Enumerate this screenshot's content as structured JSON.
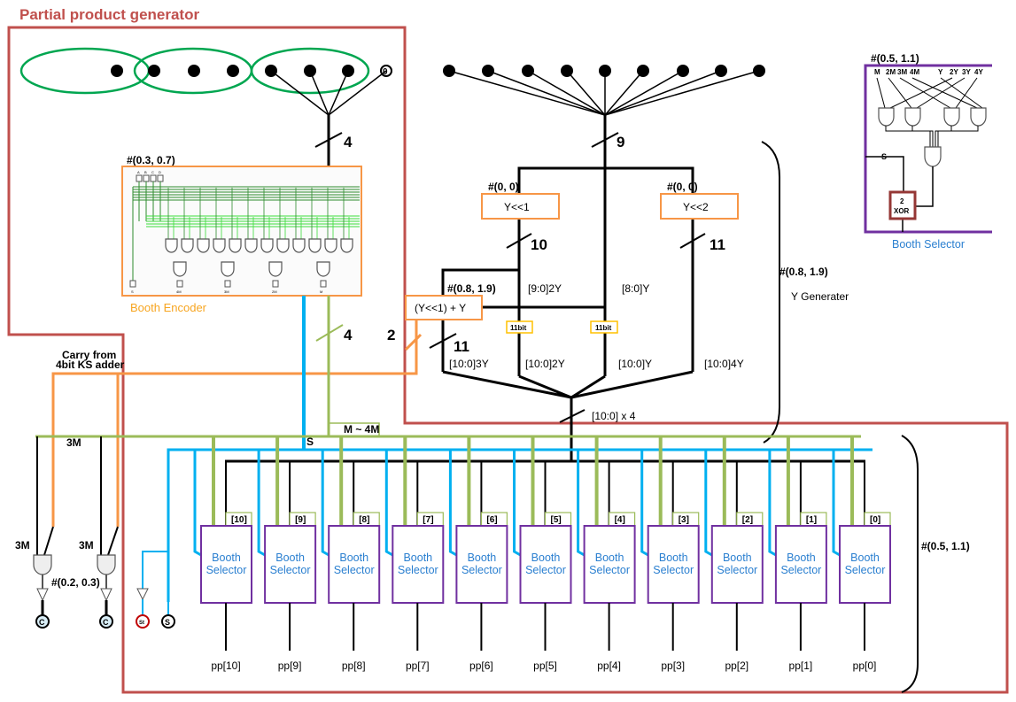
{
  "title": "Partial product generator",
  "colors": {
    "frame": "#c0504d",
    "green": "#9bbb59",
    "blue": "#00b0f0",
    "orange": "#f79646",
    "purple": "#7030a0",
    "yellow": "#ffc000",
    "brown": "#953735"
  },
  "top_left": {
    "zero_label": "0",
    "bus_width": "4"
  },
  "top_right": {
    "bus_width": "9"
  },
  "encoder": {
    "tag": "#(0.3, 0.7)",
    "label": "Booth Encoder",
    "inputs": [
      "A",
      "B",
      "C",
      "D"
    ],
    "outputs": [
      "S",
      "4M",
      "3M",
      "2M",
      "M"
    ],
    "bus_width": "4"
  },
  "ygen": {
    "shift1": "Y<<1",
    "shift1_tag": "#(0, 0)",
    "shift1_width": "10",
    "shift2": "Y<<2",
    "shift2_tag": "#(0, 0)",
    "shift2_width": "11",
    "add": "(Y<<1) + Y",
    "add_tag": "#(0.8, 1.9)",
    "add_width": "11",
    "carry_width": "2",
    "l_92y": "[9:0]2Y",
    "l_8y": "[8:0]Y",
    "ext": "11bit",
    "o3y": "[10:0]3Y",
    "o2y": "[10:0]2Y",
    "oy": "[10:0]Y",
    "o4y": "[10:0]4Y",
    "bus": "[10:0] x 4",
    "tag": "#(0.8, 1.9)",
    "label": "Y Generater"
  },
  "carry": {
    "label_1": "Carry from",
    "label_2": "4bit KS adder",
    "m3": "3M",
    "m3_a": "3M",
    "m3_b": "3M",
    "tag": "#(0.2, 0.3)",
    "out_c": "C",
    "out_st": "St",
    "out_s": "S"
  },
  "bus": {
    "m_label": "M ~ 4M",
    "s_label": "S"
  },
  "selectors": {
    "name_1": "Booth",
    "name_2": "Selector",
    "bits": [
      "[10]",
      "[9]",
      "[8]",
      "[7]",
      "[6]",
      "[5]",
      "[4]",
      "[3]",
      "[2]",
      "[1]",
      "[0]"
    ],
    "outputs": [
      "pp[10]",
      "pp[9]",
      "pp[8]",
      "pp[7]",
      "pp[6]",
      "pp[5]",
      "pp[4]",
      "pp[3]",
      "pp[2]",
      "pp[1]",
      "pp[0]"
    ],
    "tag": "#(0.5, 1.1)"
  },
  "inset": {
    "tag": "#(0.5, 1.1)",
    "inputs": [
      "M",
      "2M",
      "3M",
      "4M",
      "Y",
      "2Y",
      "3Y",
      "4Y"
    ],
    "s": "S",
    "xor_1": "2",
    "xor_2": "XOR",
    "label": "Booth Selector"
  }
}
